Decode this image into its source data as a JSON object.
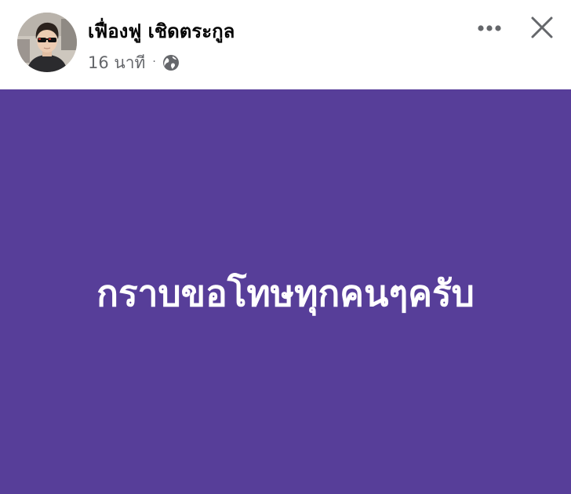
{
  "post": {
    "author_name": "เฟื่องฟู เชิดตระกูล",
    "timestamp": "16 นาที",
    "separator": "·",
    "audience_icon": "globe-icon",
    "more_icon": "more-dots-icon",
    "close_icon": "close-icon",
    "status_text": "กราบขอโทษทุกคนๆครับ",
    "colors": {
      "card_background": "#573e99",
      "status_text": "#ffffff",
      "author_name": "#050505",
      "meta_text": "#65676b",
      "header_background": "#ffffff"
    }
  }
}
